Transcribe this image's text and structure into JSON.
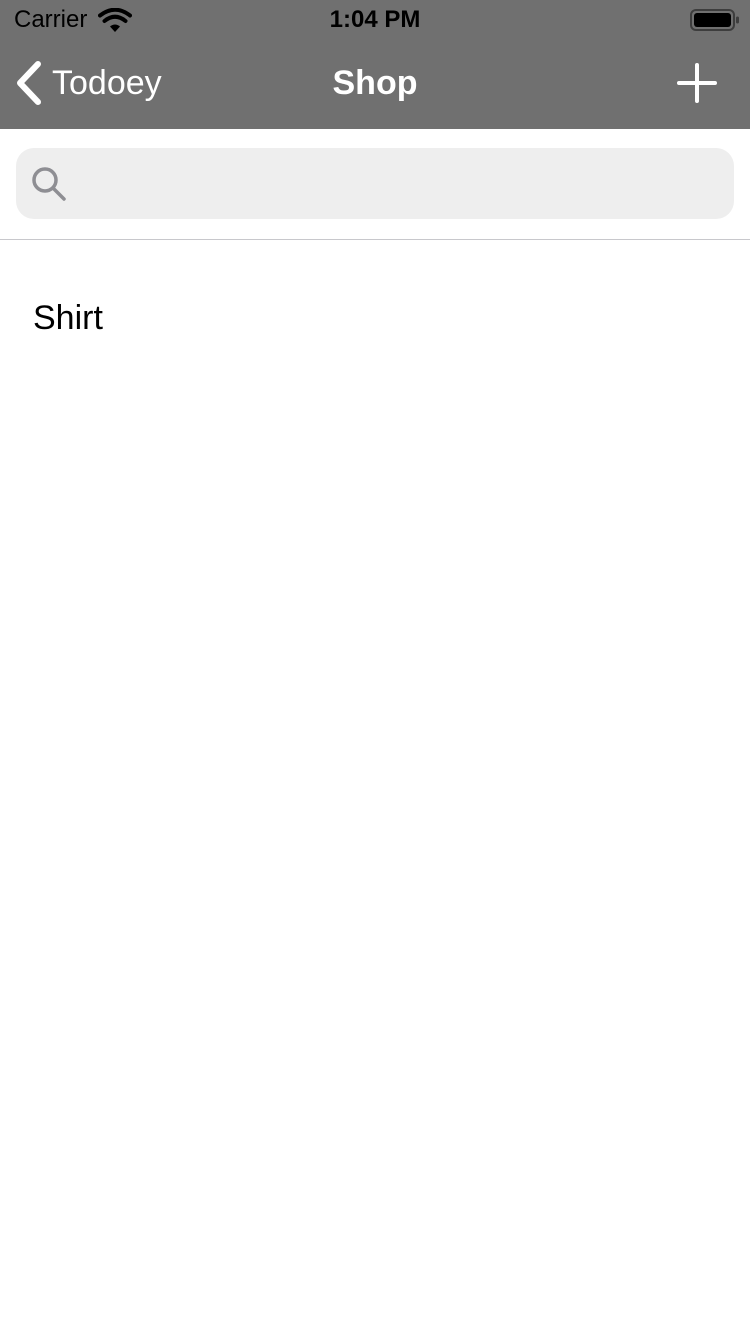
{
  "status_bar": {
    "carrier": "Carrier",
    "time": "1:04 PM",
    "wifi_icon": "wifi-icon",
    "battery_icon": "battery-icon"
  },
  "nav_bar": {
    "back_label": "Todoey",
    "title": "Shop",
    "back_icon": "chevron-left-icon",
    "add_icon": "plus-icon",
    "background_color": "#707070",
    "tint_color": "#ffffff"
  },
  "search": {
    "value": "",
    "placeholder": "",
    "icon": "search-icon"
  },
  "items": [
    {
      "title": "Shirt"
    }
  ]
}
